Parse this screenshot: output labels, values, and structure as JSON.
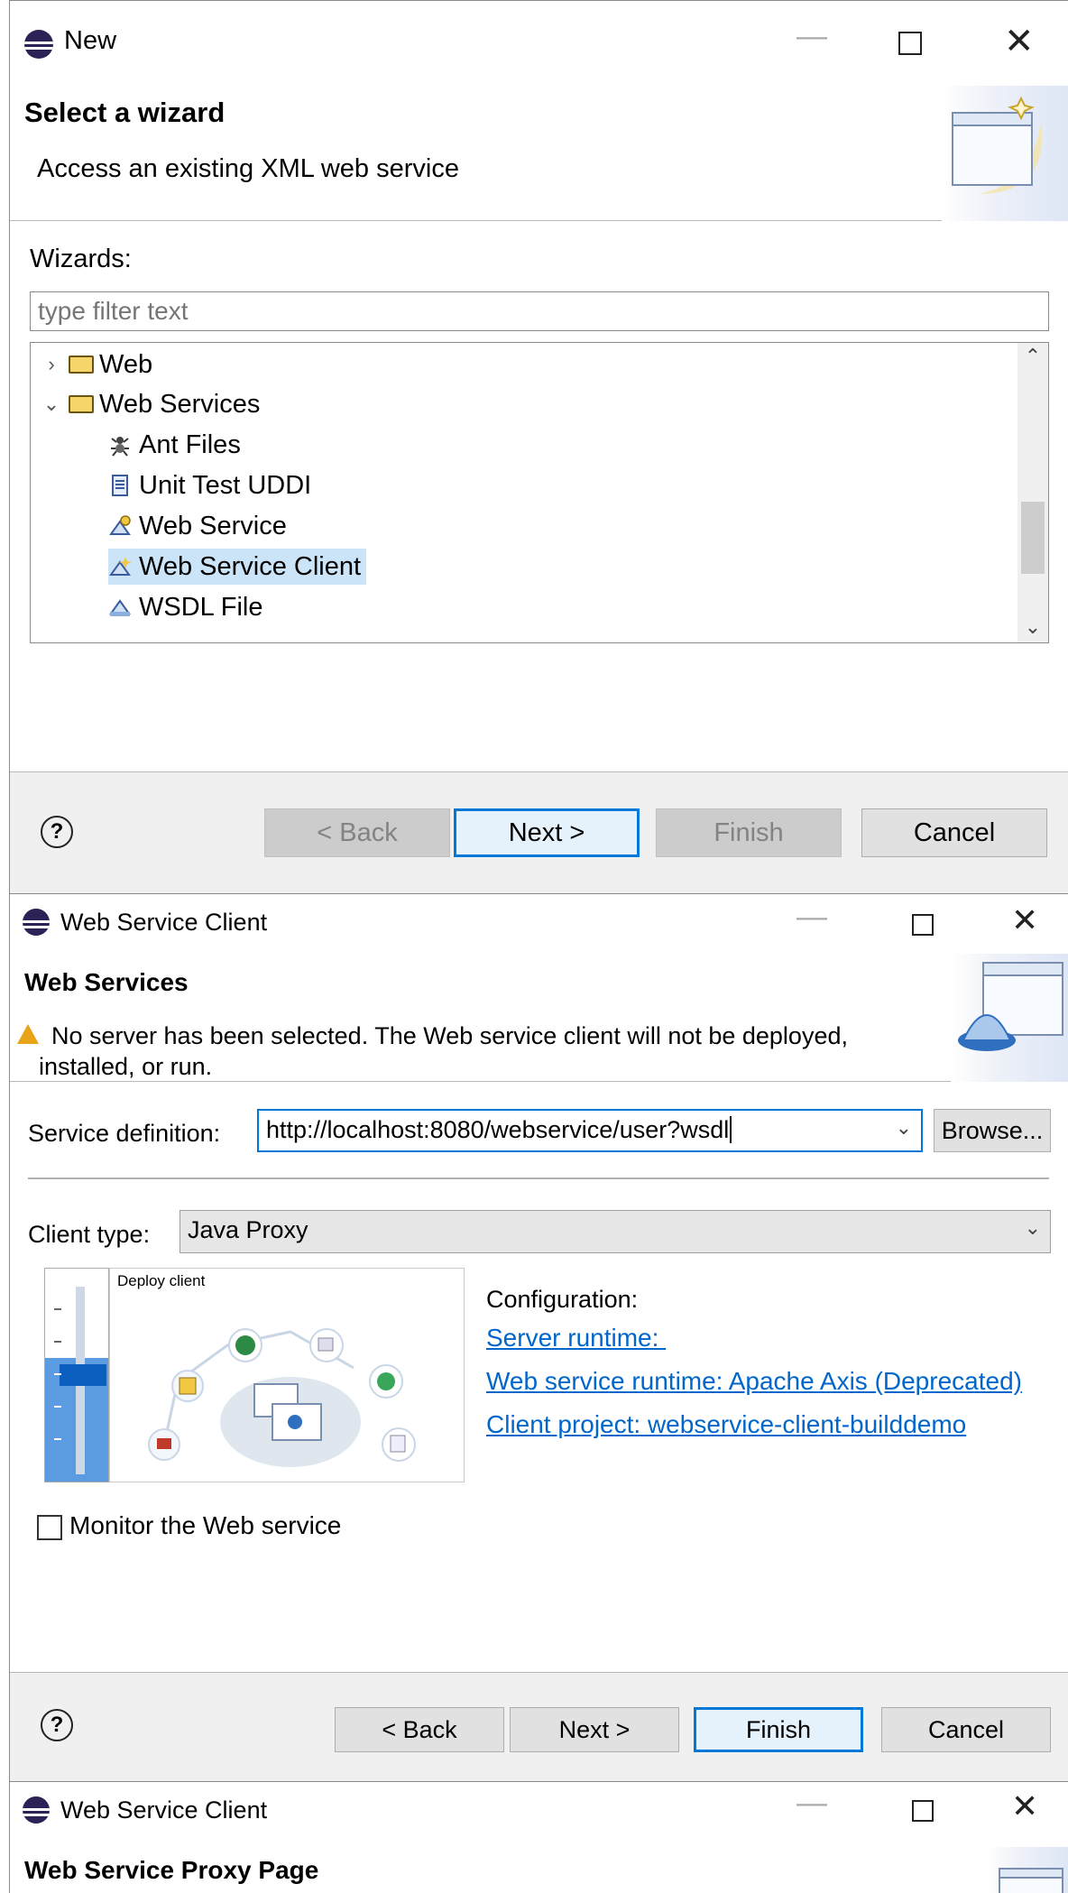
{
  "window1": {
    "title": "New",
    "header_title": "Select a wizard",
    "header_desc": "Access an existing XML web service",
    "wizards_label": "Wizards:",
    "filter_placeholder": "type filter text",
    "tree": [
      {
        "label": "Web",
        "expanded": false
      },
      {
        "label": "Web Services",
        "expanded": true
      },
      {
        "label": "Ant Files"
      },
      {
        "label": "Unit Test UDDI"
      },
      {
        "label": "Web Service"
      },
      {
        "label": "Web Service Client",
        "selected": true
      },
      {
        "label": "WSDL File"
      }
    ],
    "buttons": {
      "back": "< Back",
      "next": "Next >",
      "finish": "Finish",
      "cancel": "Cancel"
    }
  },
  "window2": {
    "title": "Web Service Client",
    "header_title": "Web Services",
    "warning_line1": "No server has been selected. The Web service client will not be deployed,",
    "warning_line2": "installed, or run.",
    "service_def_label": "Service definition:",
    "service_def_value": "http://localhost:8080/webservice/user?wsdl",
    "browse": "Browse...",
    "client_type_label": "Client type:",
    "client_type_value": "Java Proxy",
    "deploy_caption": "Deploy client",
    "slider_level": 0.42,
    "configuration_label": "Configuration:",
    "links": {
      "server_runtime": "Server runtime: ",
      "ws_runtime": "Web service runtime: Apache Axis (Deprecated)",
      "client_project": "Client project: webservice-client-builddemo"
    },
    "monitor_label": "Monitor the Web service",
    "buttons": {
      "back": "< Back",
      "next": "Next >",
      "finish": "Finish",
      "cancel": "Cancel"
    }
  },
  "window3": {
    "title": "Web Service Client",
    "header_title": "Web Service Proxy Page"
  },
  "colors": {
    "accent": "#0078d7",
    "selection": "#cce4f7",
    "link": "#0066cc",
    "warning": "#e8a317"
  }
}
